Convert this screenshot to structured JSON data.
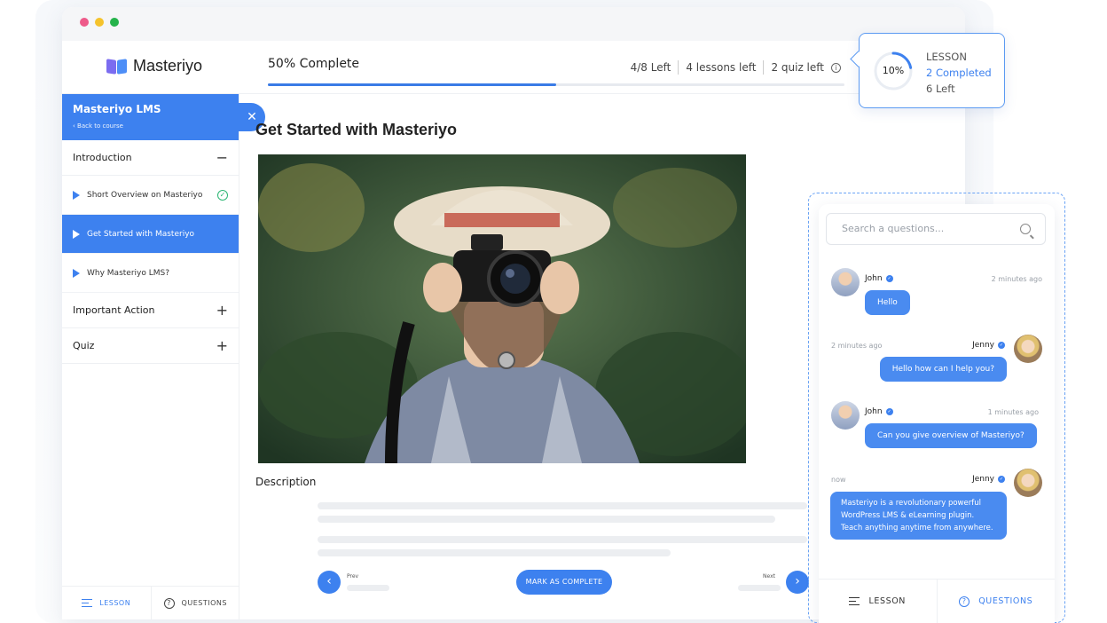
{
  "brand": {
    "name": "Masteriyo"
  },
  "progress": {
    "label": "50% Complete",
    "percent": 50
  },
  "stats": {
    "left": "4/8 Left",
    "lessons_left": "4 lessons left",
    "quiz_left": "2 quiz left"
  },
  "sidebar": {
    "course_title": "Masteriyo LMS",
    "back_link": "Back to course",
    "sections": [
      {
        "label": "Introduction",
        "toggle": "−"
      },
      {
        "label": "Important Action",
        "toggle": "+"
      },
      {
        "label": "Quiz",
        "toggle": "+"
      }
    ],
    "lessons": [
      {
        "label": "Short Overview on Masteriyo"
      },
      {
        "label": "Get Started with Masteriyo"
      },
      {
        "label": "Why Masteriyo LMS?"
      }
    ],
    "footer": {
      "lesson": "LESSON",
      "questions": "QUESTIONS"
    }
  },
  "main": {
    "title": "Get Started with Masteriyo",
    "description_label": "Description",
    "prev": "Prev",
    "next": "Next",
    "mark_complete": "MARK AS COMPLETE"
  },
  "lesson_popup": {
    "percent_label": "10%",
    "percent": 10,
    "heading": "LESSON",
    "completed": "2 Completed",
    "left": "6 Left"
  },
  "questions": {
    "search_placeholder": "Search a questions...",
    "messages": [
      {
        "user": "John",
        "time": "2  minutes ago",
        "text": "Hello"
      },
      {
        "user": "Jenny",
        "time": "2 minutes ago",
        "text": "Hello how can I help you?"
      },
      {
        "user": "John",
        "time": "1 minutes ago",
        "text": "Can you give overview of Masteriyo?"
      },
      {
        "user": "Jenny",
        "time": "now",
        "text": "Masteriyo is a revolutionary powerful WordPress LMS & eLearning plugin. Teach anything anytime from anywhere."
      }
    ],
    "footer": {
      "lesson": "LESSON",
      "questions": "QUESTIONS"
    }
  },
  "colors": {
    "accent": "#3d81ef",
    "success": "#2bb673"
  },
  "icons": [
    "close-icon",
    "play-icon",
    "check-circle-icon",
    "minus-icon",
    "plus-icon",
    "info-icon",
    "search-icon",
    "verified-badge-icon",
    "menu-icon",
    "question-icon",
    "chevron-left-icon",
    "chevron-right-icon"
  ]
}
